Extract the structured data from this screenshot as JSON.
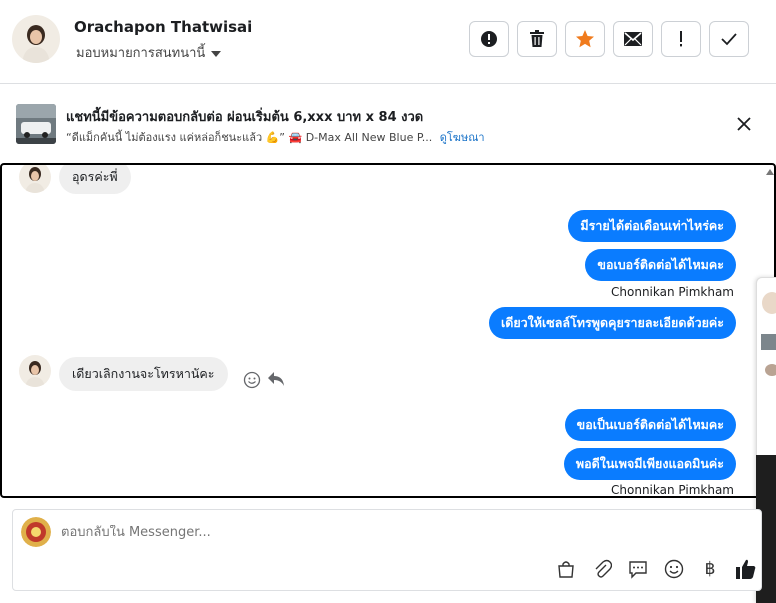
{
  "header": {
    "contact_name": "Orachapon Thatwisai",
    "assign_label": "มอบหมายการสนทนานี้",
    "actions": [
      "spam-icon",
      "trash-icon",
      "star-icon",
      "mail-icon",
      "follow-up-icon",
      "done-icon"
    ],
    "star_color": "#f07b1d"
  },
  "ad": {
    "title": "แชทนี้มีข้อความตอบกลับต่อ ผ่อนเริ่มต้น 6,xxx บาท x 84 งวด",
    "subtitle": "“ดีแม็กคันนี้ ไม่ต้องแรง แค่หล่อก็ชนะแล้ว 💪” 🚘 D-Max All New Blue P...",
    "link": "ดูโฆษณา"
  },
  "messages": [
    {
      "dir": "in",
      "text": "อุดรค่ะพี่"
    },
    {
      "dir": "out",
      "text": "มีรายได้ต่อเดือนเท่าไหร่คะ"
    },
    {
      "dir": "out",
      "text": "ขอเบอร์ติดต่อได้ไหมคะ"
    },
    {
      "dir": "sender",
      "text": "Chonnikan Pimkham"
    },
    {
      "dir": "out",
      "text": "เดียวให้เซลล์โทรพูดคุยรายละเอียดด้วยค่ะ"
    },
    {
      "dir": "in",
      "text": "เดียวเลิกงานจะโทรหานัคะ"
    },
    {
      "dir": "out",
      "text": "ขอเป็นเบอร์ติดต่อได้ไหมคะ"
    },
    {
      "dir": "out",
      "text": "พอดีในเพจมีเพียงแอดมินค่ะ"
    },
    {
      "dir": "sender",
      "text": "Chonnikan Pimkham"
    }
  ],
  "composer": {
    "placeholder": "ตอบกลับใน Messenger...",
    "tools": [
      "bag-icon",
      "attachment-icon",
      "saved-replies-icon",
      "emoji-icon",
      "baht-icon",
      "like-icon"
    ],
    "baht_symbol": "฿"
  },
  "colors": {
    "accent": "#0a7cff",
    "incoming_bubble": "#efefef",
    "link": "#1a73c8"
  }
}
